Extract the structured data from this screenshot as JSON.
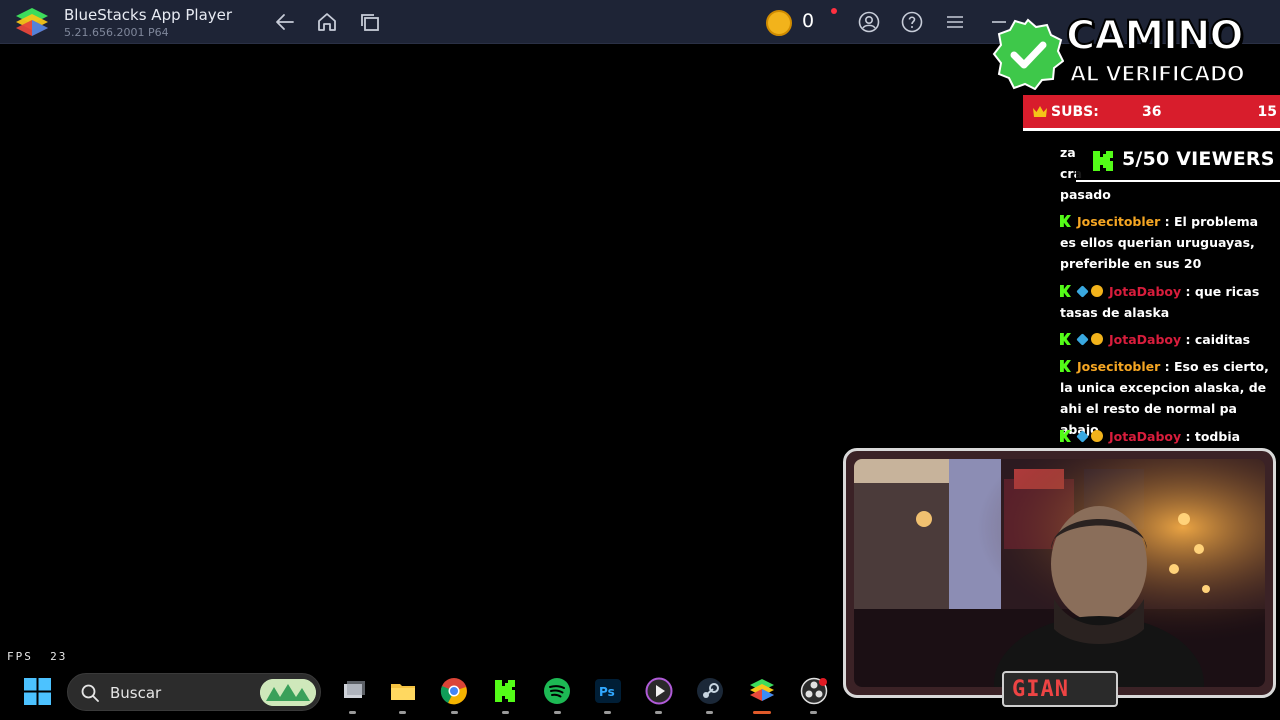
{
  "window": {
    "title": "BlueStacks App Player",
    "version": "5.21.656.2001 P64",
    "coins": "0"
  },
  "overlay": {
    "title_line1": "CAMINO",
    "title_line2": "AL VERIFICADO",
    "subs_label": "SUBS:",
    "subs_current": "36",
    "subs_goal": "15",
    "viewers_text": "5/50 VIEWERS"
  },
  "chat": {
    "messages": [
      {
        "user": "",
        "text": "za",
        "partial": true
      },
      {
        "user": "",
        "text": "cra",
        "partial": true
      },
      {
        "user": "",
        "text": "pasado",
        "partial": true
      },
      {
        "user": "Josecitobler",
        "text": ": El problema es ellos querian uruguayas, preferible en sus 20",
        "user_color": "#f5a623"
      },
      {
        "user": "JotaDaboy",
        "text": ": que ricas tasas de alaska",
        "user_color": "#d81d3c"
      },
      {
        "user": "JotaDaboy",
        "text": ": caiditas",
        "user_color": "#d81d3c"
      },
      {
        "user": "Josecitobler",
        "text": ": Eso es cierto, la unica excepcion alaska, de ahi el resto de normal pa abajo",
        "user_color": "#f5a623"
      },
      {
        "user": "JotaDaboy",
        "text": ": todbia sigues",
        "user_color": "#d81d3c"
      }
    ]
  },
  "stats": {
    "fps_label": "FPS",
    "fps_value": "23"
  },
  "webcam": {
    "name": "GIAN"
  },
  "taskbar": {
    "search_placeholder": "Buscar",
    "apps": [
      "task-view",
      "file-explorer",
      "chrome",
      "kick",
      "spotify",
      "photoshop",
      "media-player",
      "steam",
      "bluestacks",
      "obs"
    ]
  },
  "colors": {
    "titlebar": "#1e2436",
    "accent_red": "#d81d2c",
    "kick_green": "#53fc18"
  }
}
